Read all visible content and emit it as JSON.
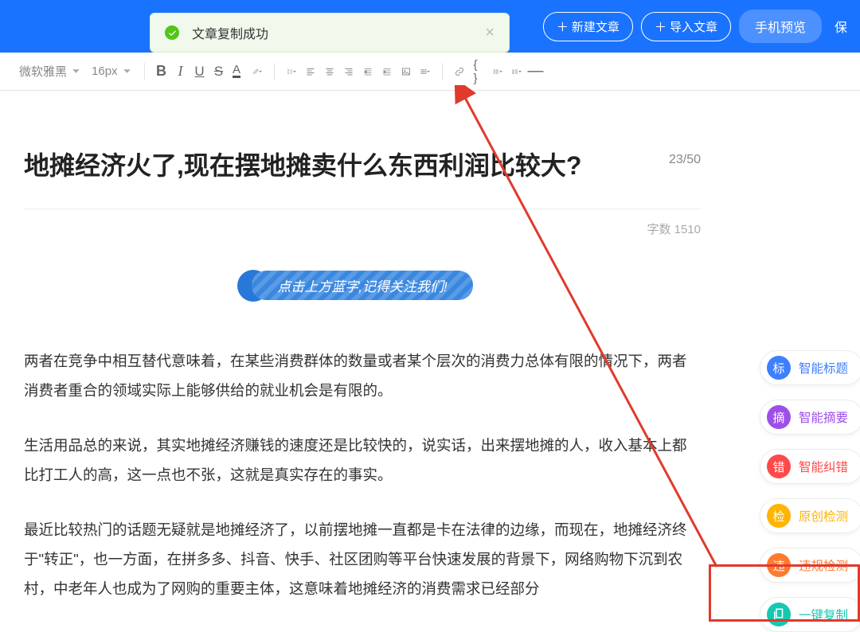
{
  "header": {
    "new_article": "新建文章",
    "import_article": "导入文章",
    "preview": "手机预览",
    "save": "保"
  },
  "toast": {
    "message": "文章复制成功"
  },
  "toolbar": {
    "font": "微软雅黑",
    "size": "16px"
  },
  "title": "地摊经济火了,现在摆地摊卖什么东西利润比较大?",
  "title_count": "23/50",
  "word_count": "字数 1510",
  "banner": "点击上方蓝字,记得关注我们!",
  "p1": "两者在竞争中相互替代意味着，在某些消费群体的数量或者某个层次的消费力总体有限的情况下，两者消费者重合的领域实际上能够供给的就业机会是有限的。",
  "p2": "生活用品总的来说，其实地摊经济赚钱的速度还是比较快的，说实话，出来摆地摊的人，收入基本上都比打工人的高，这一点也不张，这就是真实存在的事实。",
  "p3": "最近比较热门的话题无疑就是地摊经济了，以前摆地摊一直都是卡在法律的边缘，而现在，地摊经济终于\"转正\"，也一方面，在拼多多、抖音、快手、社区团购等平台快速发展的背景下，网络购物下沉到农村，中老年人也成为了网购的重要主体，这意味着地摊经济的消费需求已经部分",
  "side": {
    "title": {
      "label": "智能标题",
      "tag": "标"
    },
    "summary": {
      "label": "智能摘要",
      "tag": "摘"
    },
    "correct": {
      "label": "智能纠错",
      "tag": "错"
    },
    "original": {
      "label": "原创检测",
      "tag": "检"
    },
    "violation": {
      "label": "违规检测",
      "tag": "违"
    },
    "copy": {
      "label": "一键复制"
    }
  }
}
